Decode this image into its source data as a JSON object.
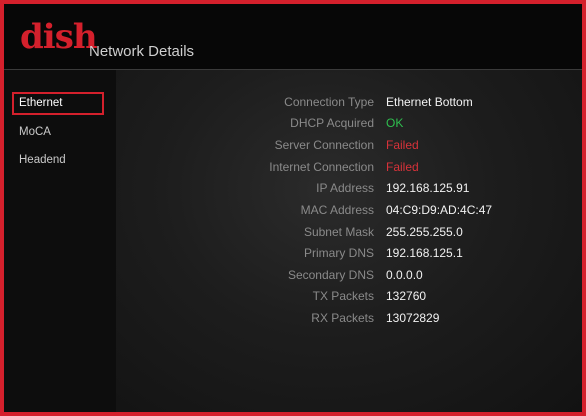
{
  "header": {
    "logo_text": "dish",
    "title": "Network Details"
  },
  "colors": {
    "brand_red": "#d4202c",
    "status_ok": "#2fbf4f",
    "status_failed": "#d8323a"
  },
  "sidebar": {
    "items": [
      {
        "label": "Ethernet",
        "selected": true
      },
      {
        "label": "MoCA",
        "selected": false
      },
      {
        "label": "Headend",
        "selected": false
      }
    ]
  },
  "details": [
    {
      "label": "Connection Type",
      "value": "Ethernet Bottom",
      "status": "normal"
    },
    {
      "label": "DHCP Acquired",
      "value": "OK",
      "status": "ok"
    },
    {
      "label": "Server Connection",
      "value": "Failed",
      "status": "failed"
    },
    {
      "label": "Internet Connection",
      "value": "Failed",
      "status": "failed"
    },
    {
      "label": "IP Address",
      "value": "192.168.125.91",
      "status": "normal"
    },
    {
      "label": "MAC Address",
      "value": "04:C9:D9:AD:4C:47",
      "status": "normal"
    },
    {
      "label": "Subnet Mask",
      "value": "255.255.255.0",
      "status": "normal"
    },
    {
      "label": "Primary DNS",
      "value": "192.168.125.1",
      "status": "normal"
    },
    {
      "label": "Secondary DNS",
      "value": "0.0.0.0",
      "status": "normal"
    },
    {
      "label": "TX Packets",
      "value": "132760",
      "status": "normal"
    },
    {
      "label": "RX Packets",
      "value": "13072829",
      "status": "normal"
    }
  ]
}
